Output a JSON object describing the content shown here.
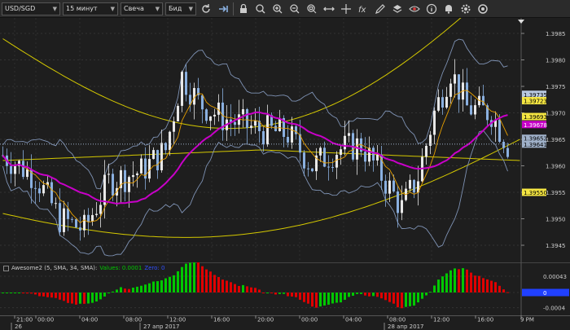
{
  "toolbar": {
    "symbol": "USD/SGD",
    "timeframe": "15 минут",
    "chart_type": "Свеча",
    "price_side": "Бид",
    "icons": [
      "refresh-icon",
      "arrow-right-icon",
      "lock-icon",
      "zoom-fit-icon",
      "zoom-in-icon",
      "zoom-out-icon",
      "zoom-reset-icon",
      "horizontal-arrows-icon",
      "crosshair-icon",
      "fx-indicator-icon",
      "pencil-icon",
      "layers-icon",
      "eye-icon",
      "info-icon",
      "alarm-icon",
      "settings-icon",
      "screenshot-icon"
    ]
  },
  "price_axis": {
    "ticks": [
      "1.3985",
      "1.3980",
      "1.3975",
      "1.3970",
      "1.3965",
      "1.3960",
      "1.3955",
      "1.3950",
      "1.3945"
    ],
    "labels": [
      {
        "text": "1.39735",
        "bg": "#b8c8e0",
        "fg": "#000000",
        "price": 1.39735
      },
      {
        "text": "1.39723",
        "bg": "#f5e642",
        "fg": "#000000",
        "price": 1.39723
      },
      {
        "text": "1.39693",
        "bg": "#f5e642",
        "fg": "#000000",
        "price": 1.39693
      },
      {
        "text": "1.39678",
        "bg": "#c800c8",
        "fg": "#ffffff",
        "price": 1.39678
      },
      {
        "text": "1.39652",
        "bg": "#9fb0c8",
        "fg": "#000000",
        "price": 1.39652
      },
      {
        "text": "1.39641",
        "bg": "#9fb0c8",
        "fg": "#000000",
        "price": 1.39641
      },
      {
        "text": "1.39550",
        "bg": "#f5e642",
        "fg": "#000000",
        "price": 1.3955
      }
    ]
  },
  "oscillator": {
    "name": "Awesome2 (5, SMA, 34, SMA):",
    "values_label": "Values: 0.0001",
    "extra_label": "Zero: 0",
    "ticks": [
      "0.00043",
      "0",
      "-0.0004"
    ],
    "zero_label": "0"
  },
  "time_axis": {
    "times": [
      "21:00",
      "00:00",
      "04:00",
      "08:00",
      "12:00",
      "16:00",
      "20:00",
      "00:00",
      "04:00",
      "08:00",
      "12:00",
      "16:00",
      "9 PM"
    ],
    "dates": [
      "26",
      "27 апр 2017",
      "28 апр 2017"
    ]
  },
  "colors": {
    "bull": "#e8e8e8",
    "bear": "#8ab0e0",
    "bollinger": "#7f93b5",
    "envelope": "#d4c800",
    "ma_purple": "#c800c8",
    "ma_orange": "#e8a000",
    "osc_up": "#00c800",
    "osc_down": "#e00000"
  }
}
